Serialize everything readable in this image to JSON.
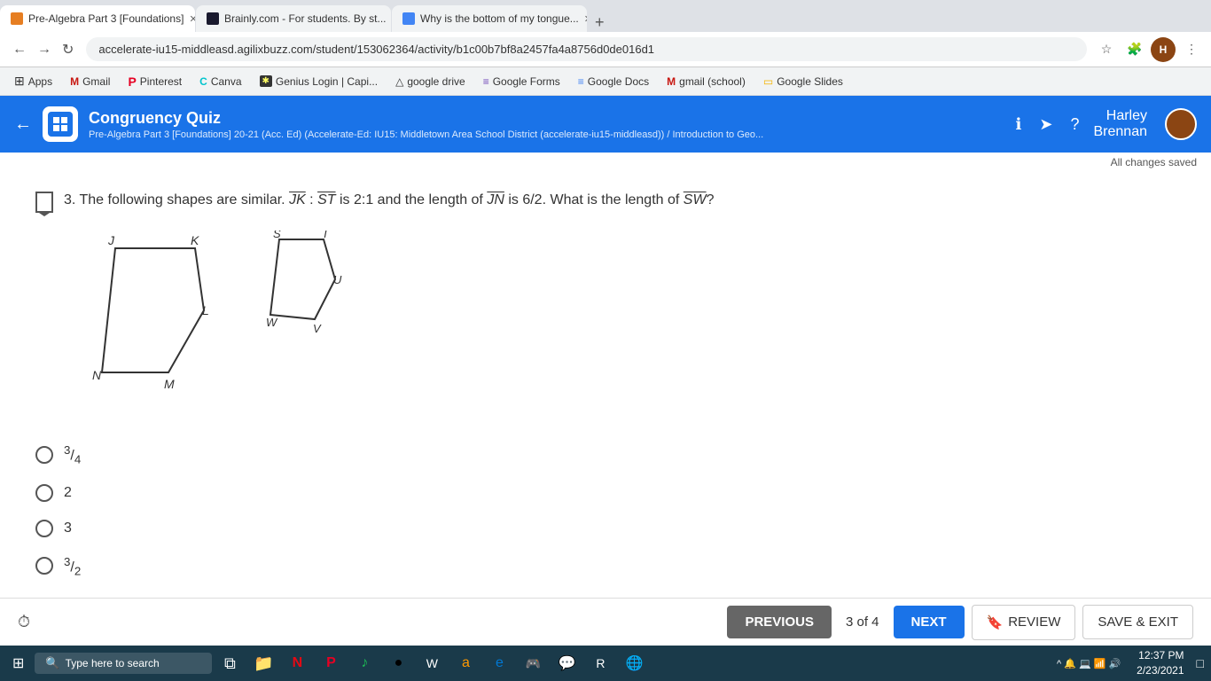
{
  "browser": {
    "tabs": [
      {
        "label": "Pre-Algebra Part 3 [Foundations]",
        "active": true,
        "favicon_color": "#e67e22"
      },
      {
        "label": "Brainly.com - For students. By st...",
        "active": false,
        "favicon_color": "#1a1a2e"
      },
      {
        "label": "Why is the bottom of my tongue...",
        "active": false,
        "favicon_color": "#4285f4"
      }
    ],
    "url": "accelerate-iu15-middleasd.agilixbuzz.com/student/153062364/activity/b1c00b7bf8a2457fa4a8756d0de016d1",
    "bookmarks": [
      {
        "label": "Apps"
      },
      {
        "label": "Gmail"
      },
      {
        "label": "Pinterest"
      },
      {
        "label": "Canva"
      },
      {
        "label": "Genius Login | Capi..."
      },
      {
        "label": "google drive"
      },
      {
        "label": "Google Forms"
      },
      {
        "label": "Google Docs"
      },
      {
        "label": "gmail (school)"
      },
      {
        "label": "Google Slides"
      }
    ]
  },
  "app": {
    "title": "Congruency Quiz",
    "subtitle": "Pre-Algebra Part 3 [Foundations] 20-21 (Acc. Ed) (Accelerate-Ed: IU15: Middletown Area School District (accelerate-iu15-middleasd)) / Introduction to Geo...",
    "all_changes_saved": "All changes saved",
    "user": {
      "first": "Harley",
      "last": "Brennan",
      "name": "Harley\nBrennan"
    }
  },
  "question": {
    "number": "3",
    "text_parts": {
      "intro": "3. The following shapes are similar. ",
      "ratio_label": "JK : ST",
      "ratio_value": " is 2:1 and the length of ",
      "jn_label": "JN",
      "jn_value": " is 6/2. What is the length of ",
      "sw_label": "SW",
      "end": "?"
    }
  },
  "answers": [
    {
      "id": "a",
      "label": "3/4",
      "type": "fraction",
      "num": "3",
      "den": "4"
    },
    {
      "id": "b",
      "label": "2",
      "type": "plain"
    },
    {
      "id": "c",
      "label": "3",
      "type": "plain"
    },
    {
      "id": "d",
      "label": "3/2",
      "type": "fraction",
      "num": "3",
      "den": "2"
    }
  ],
  "footer": {
    "previous_label": "PREVIOUS",
    "next_label": "NEXT",
    "page_current": "3",
    "page_total": "4",
    "page_display": "3 of 4",
    "review_label": "REVIEW",
    "save_exit_label": "SAVE & EXIT"
  },
  "taskbar": {
    "search_placeholder": "Type here to search",
    "time": "12:37 PM",
    "date": "2/23/2021"
  },
  "shapes": {
    "shape1_points": "J,K,L,N,M",
    "shape2_points": "S,T,U,V,W"
  }
}
